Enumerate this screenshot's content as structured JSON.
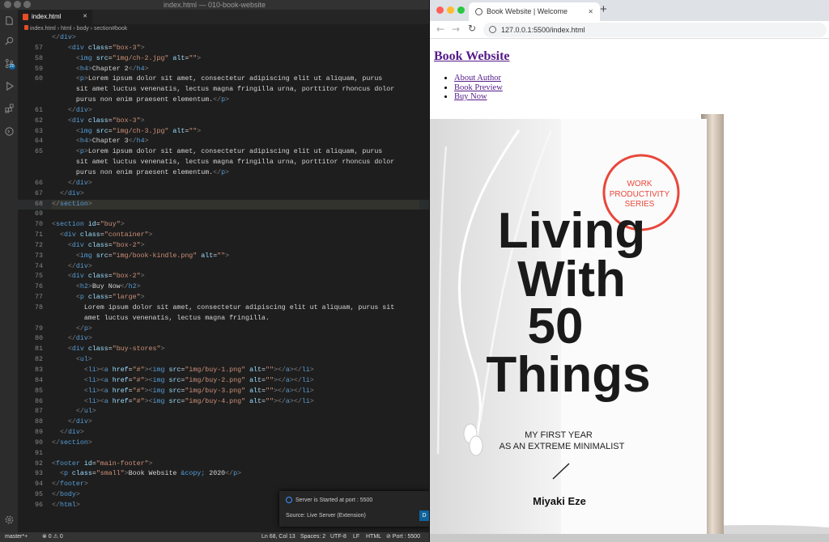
{
  "vscode": {
    "window_title": "index.html — 010-book-website",
    "tab": {
      "label": "index.html",
      "close": "✕"
    },
    "breadcrumb": {
      "file": "index.html",
      "b1": "html",
      "b2": "body",
      "b3": "section#book",
      "sep": "›"
    },
    "lines": [
      {
        "n": "",
        "html": "<span class=\"p\">&lt;/</span><span class=\"t\">div</span><span class=\"p\">&gt;</span>"
      },
      {
        "n": "57",
        "html": "    <span class=\"p\">&lt;</span><span class=\"t\">div</span> <span class=\"a\">class</span>=<span class=\"s\">\"box-3\"</span><span class=\"p\">&gt;</span>"
      },
      {
        "n": "58",
        "html": "      <span class=\"p\">&lt;</span><span class=\"t\">img</span> <span class=\"a\">src</span>=<span class=\"s\">\"img/ch-2.jpg\"</span> <span class=\"a\">alt</span>=<span class=\"s\">\"\"</span><span class=\"p\">&gt;</span>"
      },
      {
        "n": "59",
        "html": "      <span class=\"p\">&lt;</span><span class=\"t\">h4</span><span class=\"p\">&gt;</span>Chapter 2<span class=\"p\">&lt;/</span><span class=\"t\">h4</span><span class=\"p\">&gt;</span>"
      },
      {
        "n": "60",
        "html": "      <span class=\"p\">&lt;</span><span class=\"t\">p</span><span class=\"p\">&gt;</span>Lorem ipsum dolor sit amet, consectetur adipiscing elit ut aliquam, purus"
      },
      {
        "n": "",
        "html": "      sit amet luctus venenatis, lectus magna fringilla urna, porttitor rhoncus dolor"
      },
      {
        "n": "",
        "html": "      purus non enim praesent elementum.<span class=\"p\">&lt;/</span><span class=\"t\">p</span><span class=\"p\">&gt;</span>"
      },
      {
        "n": "61",
        "html": "    <span class=\"p\">&lt;/</span><span class=\"t\">div</span><span class=\"p\">&gt;</span>"
      },
      {
        "n": "62",
        "html": "    <span class=\"p\">&lt;</span><span class=\"t\">div</span> <span class=\"a\">class</span>=<span class=\"s\">\"box-3\"</span><span class=\"p\">&gt;</span>"
      },
      {
        "n": "63",
        "html": "      <span class=\"p\">&lt;</span><span class=\"t\">img</span> <span class=\"a\">src</span>=<span class=\"s\">\"img/ch-3.jpg\"</span> <span class=\"a\">alt</span>=<span class=\"s\">\"\"</span><span class=\"p\">&gt;</span>"
      },
      {
        "n": "64",
        "html": "      <span class=\"p\">&lt;</span><span class=\"t\">h4</span><span class=\"p\">&gt;</span>Chapter 3<span class=\"p\">&lt;/</span><span class=\"t\">h4</span><span class=\"p\">&gt;</span>"
      },
      {
        "n": "65",
        "html": "      <span class=\"p\">&lt;</span><span class=\"t\">p</span><span class=\"p\">&gt;</span>Lorem ipsum dolor sit amet, consectetur adipiscing elit ut aliquam, purus"
      },
      {
        "n": "",
        "html": "      sit amet luctus venenatis, lectus magna fringilla urna, porttitor rhoncus dolor"
      },
      {
        "n": "",
        "html": "      purus non enim praesent elementum.<span class=\"p\">&lt;/</span><span class=\"t\">p</span><span class=\"p\">&gt;</span>"
      },
      {
        "n": "66",
        "html": "    <span class=\"p\">&lt;/</span><span class=\"t\">div</span><span class=\"p\">&gt;</span>"
      },
      {
        "n": "67",
        "html": "  <span class=\"p\">&lt;/</span><span class=\"t\">div</span><span class=\"p\">&gt;</span>"
      },
      {
        "n": "68",
        "html": "<span class=\"p\">&lt;/</span><span class=\"t\">section</span><span class=\"p\">&gt;</span>",
        "hl": true
      },
      {
        "n": "69",
        "html": ""
      },
      {
        "n": "70",
        "html": "<span class=\"p\">&lt;</span><span class=\"t\">section</span> <span class=\"a\">id</span>=<span class=\"s\">\"buy\"</span><span class=\"p\">&gt;</span>"
      },
      {
        "n": "71",
        "html": "  <span class=\"p\">&lt;</span><span class=\"t\">div</span> <span class=\"a\">class</span>=<span class=\"s\">\"container\"</span><span class=\"p\">&gt;</span>"
      },
      {
        "n": "72",
        "html": "    <span class=\"p\">&lt;</span><span class=\"t\">div</span> <span class=\"a\">class</span>=<span class=\"s\">\"box-2\"</span><span class=\"p\">&gt;</span>"
      },
      {
        "n": "73",
        "html": "      <span class=\"p\">&lt;</span><span class=\"t\">img</span> <span class=\"a\">src</span>=<span class=\"s\">\"img/book-kindle.png\"</span> <span class=\"a\">alt</span>=<span class=\"s\">\"\"</span><span class=\"p\">&gt;</span>"
      },
      {
        "n": "74",
        "html": "    <span class=\"p\">&lt;/</span><span class=\"t\">div</span><span class=\"p\">&gt;</span>"
      },
      {
        "n": "75",
        "html": "    <span class=\"p\">&lt;</span><span class=\"t\">div</span> <span class=\"a\">class</span>=<span class=\"s\">\"box-2\"</span><span class=\"p\">&gt;</span>"
      },
      {
        "n": "76",
        "html": "      <span class=\"p\">&lt;</span><span class=\"t\">h2</span><span class=\"p\">&gt;</span>Buy Now<span class=\"p\">&lt;/</span><span class=\"t\">h2</span><span class=\"p\">&gt;</span>"
      },
      {
        "n": "77",
        "html": "      <span class=\"p\">&lt;</span><span class=\"t\">p</span> <span class=\"a\">class</span>=<span class=\"s\">\"large\"</span><span class=\"p\">&gt;</span>"
      },
      {
        "n": "78",
        "html": "        Lorem ipsum dolor sit amet, consectetur adipiscing elit ut aliquam, purus sit"
      },
      {
        "n": "",
        "html": "        amet luctus venenatis, lectus magna fringilla."
      },
      {
        "n": "79",
        "html": "      <span class=\"p\">&lt;/</span><span class=\"t\">p</span><span class=\"p\">&gt;</span>"
      },
      {
        "n": "80",
        "html": "    <span class=\"p\">&lt;/</span><span class=\"t\">div</span><span class=\"p\">&gt;</span>"
      },
      {
        "n": "81",
        "html": "    <span class=\"p\">&lt;</span><span class=\"t\">div</span> <span class=\"a\">class</span>=<span class=\"s\">\"buy-stores\"</span><span class=\"p\">&gt;</span>"
      },
      {
        "n": "82",
        "html": "      <span class=\"p\">&lt;</span><span class=\"t\">ul</span><span class=\"p\">&gt;</span>"
      },
      {
        "n": "83",
        "html": "        <span class=\"p\">&lt;</span><span class=\"t\">li</span><span class=\"p\">&gt;&lt;</span><span class=\"t\">a</span> <span class=\"a\">href</span>=<span class=\"s\">\"#\"</span><span class=\"p\">&gt;&lt;</span><span class=\"t\">img</span> <span class=\"a\">src</span>=<span class=\"s\">\"img/buy-1.png\"</span> <span class=\"a\">alt</span>=<span class=\"s\">\"\"</span><span class=\"p\">&gt;&lt;/</span><span class=\"t\">a</span><span class=\"p\">&gt;&lt;/</span><span class=\"t\">li</span><span class=\"p\">&gt;</span>"
      },
      {
        "n": "84",
        "html": "        <span class=\"p\">&lt;</span><span class=\"t\">li</span><span class=\"p\">&gt;&lt;</span><span class=\"t\">a</span> <span class=\"a\">href</span>=<span class=\"s\">\"#\"</span><span class=\"p\">&gt;&lt;</span><span class=\"t\">img</span> <span class=\"a\">src</span>=<span class=\"s\">\"img/buy-2.png\"</span> <span class=\"a\">alt</span>=<span class=\"s\">\"\"</span><span class=\"p\">&gt;&lt;/</span><span class=\"t\">a</span><span class=\"p\">&gt;&lt;/</span><span class=\"t\">li</span><span class=\"p\">&gt;</span>"
      },
      {
        "n": "85",
        "html": "        <span class=\"p\">&lt;</span><span class=\"t\">li</span><span class=\"p\">&gt;&lt;</span><span class=\"t\">a</span> <span class=\"a\">href</span>=<span class=\"s\">\"#\"</span><span class=\"p\">&gt;&lt;</span><span class=\"t\">img</span> <span class=\"a\">src</span>=<span class=\"s\">\"img/buy-3.png\"</span> <span class=\"a\">alt</span>=<span class=\"s\">\"\"</span><span class=\"p\">&gt;&lt;/</span><span class=\"t\">a</span><span class=\"p\">&gt;&lt;/</span><span class=\"t\">li</span><span class=\"p\">&gt;</span>"
      },
      {
        "n": "86",
        "html": "        <span class=\"p\">&lt;</span><span class=\"t\">li</span><span class=\"p\">&gt;&lt;</span><span class=\"t\">a</span> <span class=\"a\">href</span>=<span class=\"s\">\"#\"</span><span class=\"p\">&gt;&lt;</span><span class=\"t\">img</span> <span class=\"a\">src</span>=<span class=\"s\">\"img/buy-4.png\"</span> <span class=\"a\">alt</span>=<span class=\"s\">\"\"</span><span class=\"p\">&gt;&lt;/</span><span class=\"t\">a</span><span class=\"p\">&gt;&lt;/</span><span class=\"t\">li</span><span class=\"p\">&gt;</span>"
      },
      {
        "n": "87",
        "html": "      <span class=\"p\">&lt;/</span><span class=\"t\">ul</span><span class=\"p\">&gt;</span>"
      },
      {
        "n": "88",
        "html": "    <span class=\"p\">&lt;/</span><span class=\"t\">div</span><span class=\"p\">&gt;</span>"
      },
      {
        "n": "89",
        "html": "  <span class=\"p\">&lt;/</span><span class=\"t\">div</span><span class=\"p\">&gt;</span>"
      },
      {
        "n": "90",
        "html": "<span class=\"p\">&lt;/</span><span class=\"t\">section</span><span class=\"p\">&gt;</span>"
      },
      {
        "n": "91",
        "html": ""
      },
      {
        "n": "92",
        "html": "<span class=\"p\">&lt;</span><span class=\"t\">footer</span> <span class=\"a\">id</span>=<span class=\"s\">\"main-footer\"</span><span class=\"p\">&gt;</span>"
      },
      {
        "n": "93",
        "html": "  <span class=\"p\">&lt;</span><span class=\"t\">p</span> <span class=\"a\">class</span>=<span class=\"s\">\"small\"</span><span class=\"p\">&gt;</span>Book Website <span class=\"e\">&amp;copy;</span> 2020<span class=\"p\">&lt;/</span><span class=\"t\">p</span><span class=\"p\">&gt;</span>"
      },
      {
        "n": "94",
        "html": "<span class=\"p\">&lt;/</span><span class=\"t\">footer</span><span class=\"p\">&gt;</span>"
      },
      {
        "n": "95",
        "html": "<span class=\"p\">&lt;/</span><span class=\"t\">body</span><span class=\"p\">&gt;</span>"
      },
      {
        "n": "96",
        "html": "<span class=\"p\">&lt;/</span><span class=\"t\">html</span><span class=\"p\">&gt;</span>"
      }
    ],
    "notification": {
      "message": "Server is Started at port : 5500",
      "source": "Source: Live Server (Extension)",
      "button": "D"
    },
    "status": {
      "branch": "master*+",
      "problems": "⊗ 0 ⚠ 0",
      "position": "Ln 68, Col 13",
      "spaces": "Spaces: 2",
      "encoding": "UTF-8",
      "eol": "LF",
      "language": "HTML",
      "port": "⊘ Port : 5500"
    },
    "badge": "20"
  },
  "browser": {
    "tab_title": "Book Website | Welcome",
    "tab_close": "✕",
    "new_tab": "+",
    "url": "127.0.0.1:5500/index.html",
    "page": {
      "title": "Book Website",
      "nav": [
        "About Author",
        "Book Preview",
        "Buy Now"
      ],
      "cover": {
        "badge": [
          "WORK",
          "PRODUCTIVITY",
          "SERIES"
        ],
        "title_lines": [
          "Living",
          "With",
          "50",
          "Things"
        ],
        "subtitle_lines": [
          "MY FIRST YEAR",
          "AS AN EXTREME MINIMALIST"
        ],
        "author": "Miyaki Eze"
      }
    }
  },
  "colors": {
    "accent": "#e8483b",
    "link": "#551a8b",
    "editor_bg": "#1e1e1e"
  }
}
